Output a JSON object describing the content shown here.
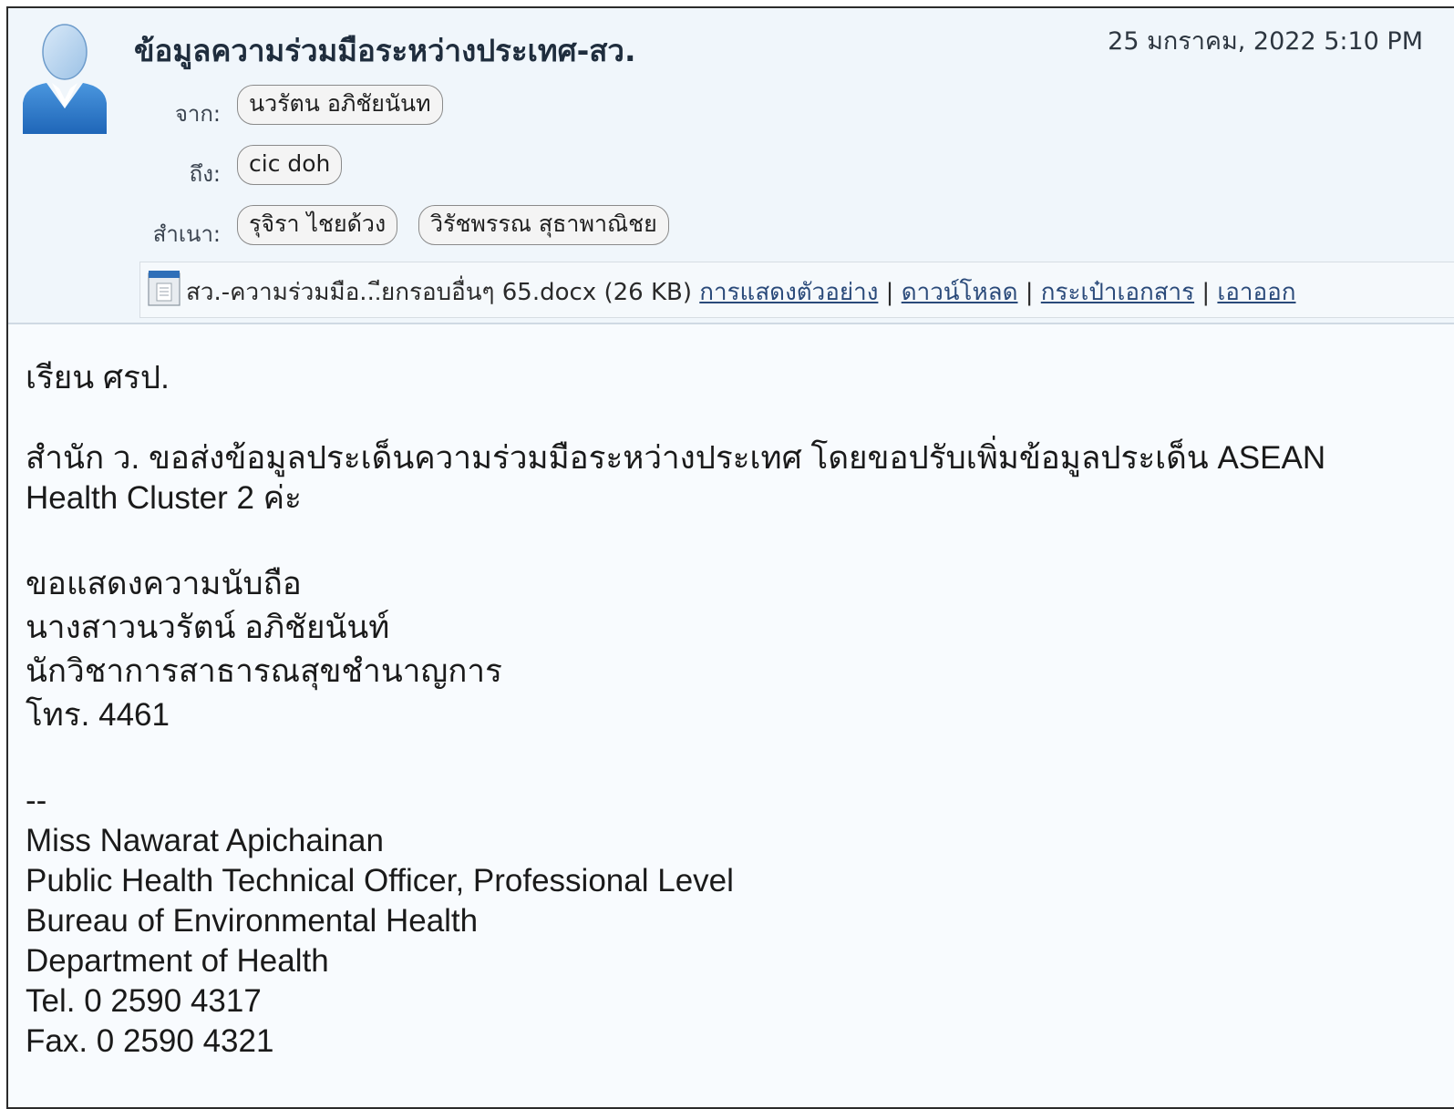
{
  "email": {
    "subject": "ข้อมูลความร่วมมือระหว่างประเทศ-สว.",
    "date": "25 มกราคม, 2022 5:10 PM",
    "from_label": "จาก:",
    "from": [
      "นวรัตน อภิชัยนันท"
    ],
    "to_label": "ถึง:",
    "to": [
      "cic doh"
    ],
    "cc_label": "สำเนา:",
    "cc": [
      "รุจิรา ไชยด้วง",
      "วิรัชพรรณ สุธาพาณิชย"
    ],
    "avatar_icon": "user-avatar-icon"
  },
  "attachment": {
    "icon": "document-icon",
    "filename": "สว.-ความร่วมมือ...ียกรอบอื่นๆ 65.docx",
    "size": "(26 KB)",
    "actions": [
      "การแสดงตัวอย่าง",
      "ดาวน์โหลด",
      "กระเป๋าเอกสาร",
      "เอาออก"
    ],
    "separator": "|"
  },
  "body": {
    "greeting": "เรียน ศรป.",
    "paragraph_line1": "สำนัก ว. ขอส่งข้อมูลประเด็นความร่วมมือระหว่างประเทศ โดยขอปรับเพิ่มข้อมูลประเด็น ASEAN",
    "paragraph_line2": "Health Cluster 2 ค่ะ",
    "closing": "ขอแสดงความนับถือ",
    "name_th": "นางสาวนวรัตน์ อภิชัยนันท์",
    "position_th": "นักวิชาการสาธารณสุขชำนาญการ",
    "phone_th": "โทร. 4461",
    "sig_dash": "--",
    "name_en": "Miss Nawarat Apichainan",
    "position_en": "Public Health Technical Officer, Professional Level",
    "bureau_en": "Bureau of Environmental Health",
    "dept_en": "Department of Health",
    "tel_en": "Tel. 0 2590 4317",
    "fax_en": "Fax. 0 2590 4321"
  }
}
